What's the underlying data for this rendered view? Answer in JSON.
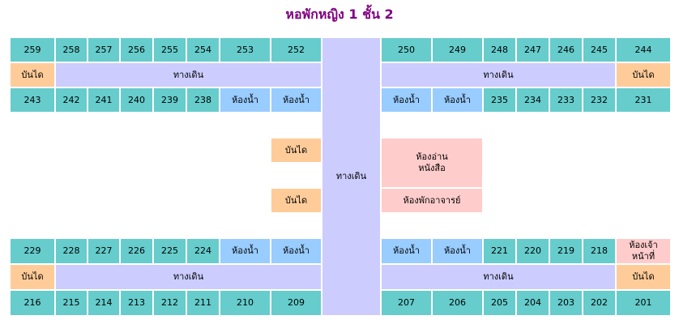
{
  "title": "หอพักหญิง 1 ชั้น 2",
  "labels": {
    "stair": "บันได",
    "walkway": "ทางเดิน",
    "bathroom": "ห้องน้ำ",
    "reading_room": "ห้องอ่าน\nหนังสือ",
    "teacher_room": "ห้องพักอาจารย์",
    "staff_room": "ห้องเจ้า\nหน้าที่"
  },
  "rows": {
    "top_left": [
      "259",
      "258",
      "257",
      "256",
      "255",
      "254",
      "253",
      "252"
    ],
    "top_right": [
      "250",
      "249",
      "248",
      "247",
      "246",
      "245",
      "244"
    ],
    "upper_left": [
      "243",
      "242",
      "241",
      "240",
      "239",
      "238"
    ],
    "upper_right": [
      "235",
      "234",
      "233",
      "232",
      "231"
    ],
    "lower_left": [
      "229",
      "228",
      "227",
      "226",
      "225",
      "224"
    ],
    "lower_right": [
      "221",
      "220",
      "219",
      "218"
    ],
    "bottom_left": [
      "216",
      "215",
      "214",
      "213",
      "212",
      "211",
      "210",
      "209"
    ],
    "bottom_right": [
      "207",
      "206",
      "205",
      "204",
      "203",
      "202",
      "201"
    ]
  },
  "colors": {
    "title": "#800080",
    "room": "#66cccc",
    "bathroom": "#99ccff",
    "walkway": "#ccccff",
    "stair": "#ffcc99",
    "special": "#ffcccc"
  }
}
